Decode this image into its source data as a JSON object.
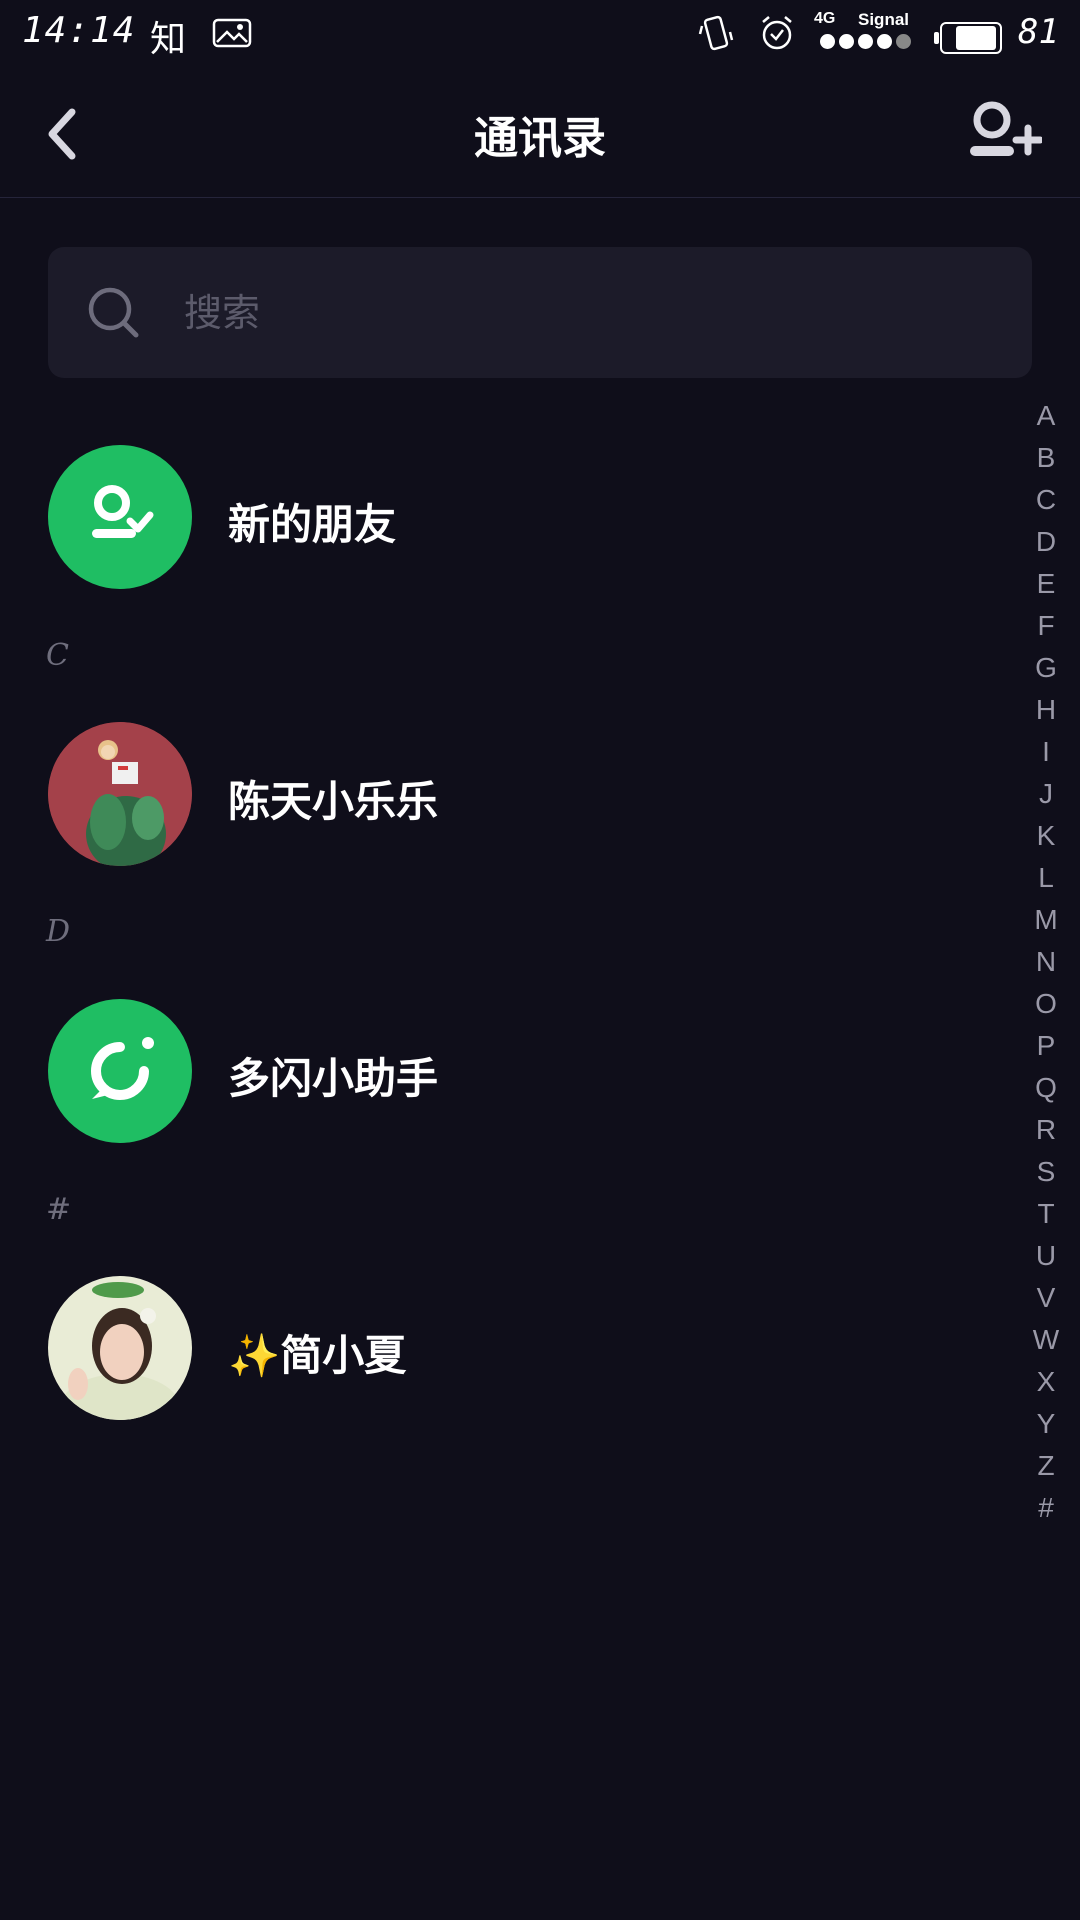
{
  "status_bar": {
    "time": "14:14",
    "app_glyph": "知",
    "network": "4G",
    "signal_label": "Signal",
    "signal_bars_on": 4,
    "signal_bars_total": 5,
    "battery_level": "81"
  },
  "header": {
    "title": "通讯录",
    "back_icon": "chevron-left-icon",
    "add_icon": "add-user-icon"
  },
  "search": {
    "placeholder": "搜索",
    "value": ""
  },
  "contacts": [
    {
      "section": "",
      "name": "新的朋友",
      "avatar": "new-friend-icon",
      "avatar_color": "#1fbe63"
    },
    {
      "section": "C",
      "name": "陈天小乐乐",
      "avatar": "photo"
    },
    {
      "section": "D",
      "name": "多闪小助手",
      "avatar": "assistant-icon",
      "avatar_color": "#1fbe63"
    },
    {
      "section": "#",
      "name": "✨简小夏",
      "avatar": "photo"
    }
  ],
  "index_letters": [
    "A",
    "B",
    "C",
    "D",
    "E",
    "F",
    "G",
    "H",
    "I",
    "J",
    "K",
    "L",
    "M",
    "N",
    "O",
    "P",
    "Q",
    "R",
    "S",
    "T",
    "U",
    "V",
    "W",
    "X",
    "Y",
    "Z",
    "#"
  ],
  "colors": {
    "background": "#0f0e1a",
    "accent_green": "#1fbe63",
    "search_bg": "#1c1b29",
    "index_text": "#9a99a8"
  }
}
